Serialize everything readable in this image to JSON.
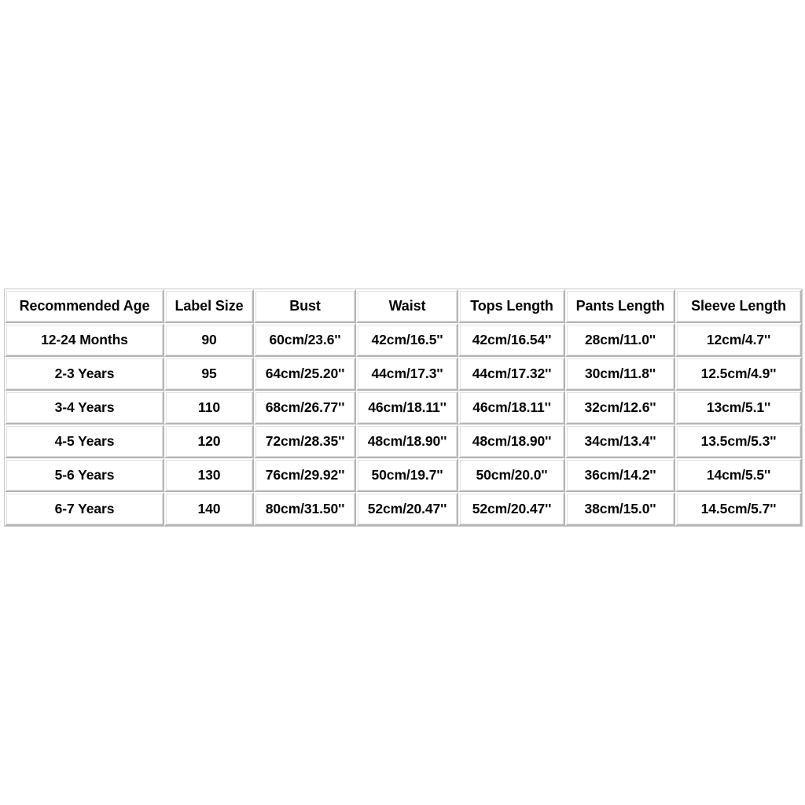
{
  "chart_data": {
    "type": "table",
    "title": "",
    "columns": [
      "Recommended Age",
      "Label Size",
      "Bust",
      "Waist",
      "Tops Length",
      "Pants Length",
      "Sleeve Length"
    ],
    "rows": [
      [
        "12-24 Months",
        "90",
        "60cm/23.6''",
        "42cm/16.5''",
        "42cm/16.54''",
        "28cm/11.0''",
        "12cm/4.7''"
      ],
      [
        "2-3 Years",
        "95",
        "64cm/25.20''",
        "44cm/17.3''",
        "44cm/17.32''",
        "30cm/11.8''",
        "12.5cm/4.9''"
      ],
      [
        "3-4 Years",
        "110",
        "68cm/26.77''",
        "46cm/18.11''",
        "46cm/18.11''",
        "32cm/12.6''",
        "13cm/5.1''"
      ],
      [
        "4-5 Years",
        "120",
        "72cm/28.35''",
        "48cm/18.90''",
        "48cm/18.90''",
        "34cm/13.4''",
        "13.5cm/5.3''"
      ],
      [
        "5-6 Years",
        "130",
        "76cm/29.92''",
        "50cm/19.7''",
        "50cm/20.0''",
        "36cm/14.2''",
        "14cm/5.5''"
      ],
      [
        "6-7 Years",
        "140",
        "80cm/31.50''",
        "52cm/20.47''",
        "52cm/20.47''",
        "38cm/15.0''",
        "14.5cm/5.7''"
      ]
    ],
    "colors": {
      "background": "#ffffff",
      "text": "#050505",
      "cell_background": "#ffffff",
      "border_light": "#ffffff",
      "border_dark": "#b4b4b4",
      "border_outer": "#c9c9c9"
    }
  }
}
